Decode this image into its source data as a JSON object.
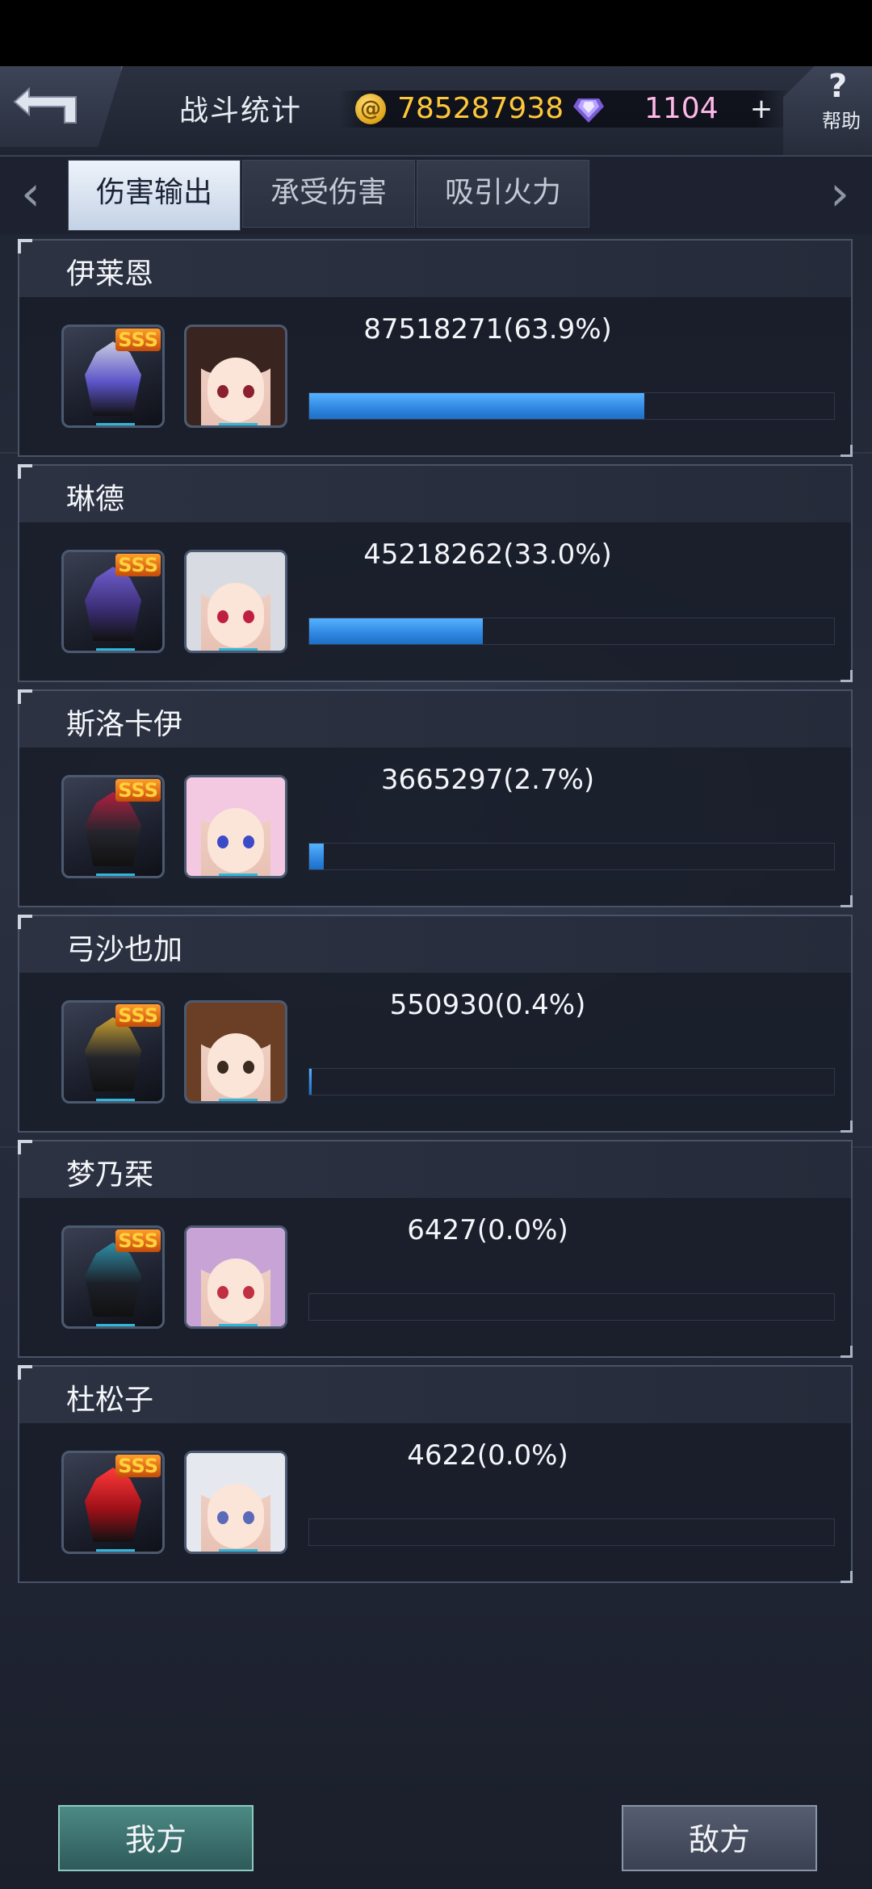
{
  "header": {
    "title": "战斗统计",
    "gold": "785287938",
    "gems": "1104",
    "plus": "+",
    "help_q": "?",
    "help_label": "帮助"
  },
  "tabs": [
    {
      "label": "伤害输出",
      "active": true
    },
    {
      "label": "承受伤害",
      "active": false
    },
    {
      "label": "吸引火力",
      "active": false
    }
  ],
  "nav": {
    "left": "‹",
    "right": "›"
  },
  "units": [
    {
      "name": "伊莱恩",
      "damage_text": "87518271(63.9%)",
      "percent": 63.9,
      "mech": "purple-silver",
      "pilot_hair": "dark-brown",
      "badge": "SSS"
    },
    {
      "name": "琳德",
      "damage_text": "45218262(33.0%)",
      "percent": 33.0,
      "mech": "dark-violet",
      "pilot_hair": "silver",
      "badge": "SSS"
    },
    {
      "name": "斯洛卡伊",
      "damage_text": "3665297(2.7%)",
      "percent": 2.7,
      "mech": "black-red",
      "pilot_hair": "pink-white",
      "badge": "SSS"
    },
    {
      "name": "弓沙也加",
      "damage_text": "550930(0.4%)",
      "percent": 0.4,
      "mech": "black-gold",
      "pilot_hair": "brown",
      "badge": "SSS"
    },
    {
      "name": "梦乃栞",
      "damage_text": "6427(0.0%)",
      "percent": 0.0,
      "mech": "black-teal",
      "pilot_hair": "lavender",
      "badge": "SSS"
    },
    {
      "name": "杜松子",
      "damage_text": "4622(0.0%)",
      "percent": 0.0,
      "mech": "crimson",
      "pilot_hair": "white",
      "badge": "SSS"
    }
  ],
  "bottom": {
    "ours": "我方",
    "enemy": "敌方"
  },
  "colors": {
    "accent_bar": "#2f86e0",
    "gold": "#ffc83a",
    "badge": "#ffd23c"
  }
}
